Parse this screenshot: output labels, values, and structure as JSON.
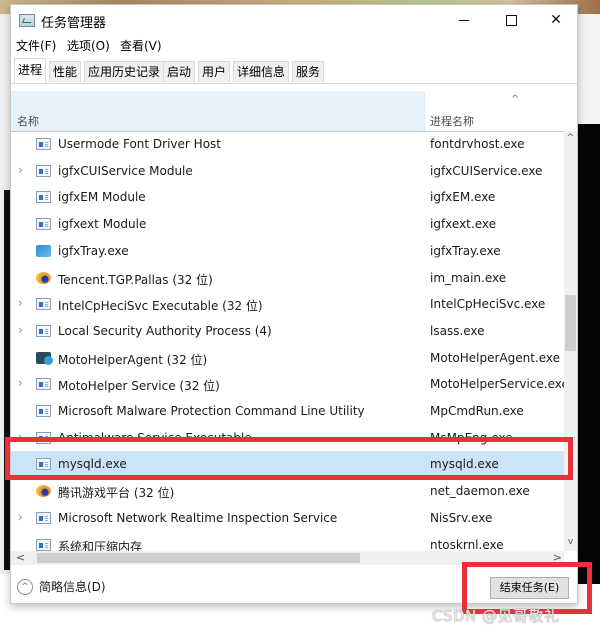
{
  "window": {
    "title": "任务管理器",
    "controls": {
      "minimize": "minimize",
      "maximize": "maximize",
      "close": "✕"
    }
  },
  "menu": [
    "文件(F)",
    "选项(O)",
    "查看(V)"
  ],
  "tabs": [
    {
      "label": "进程",
      "active": true
    },
    {
      "label": "性能"
    },
    {
      "label": "应用历史记录"
    },
    {
      "label": "启动"
    },
    {
      "label": "用户"
    },
    {
      "label": "详细信息"
    },
    {
      "label": "服务"
    }
  ],
  "table": {
    "columns": {
      "name": "名称",
      "process_name": "进程名称",
      "sort_indicator": "^"
    },
    "rows": [
      {
        "name": "Usermode Font Driver Host",
        "process": "fontdrvhost.exe",
        "expandable": false,
        "icon": "window-icon"
      },
      {
        "name": "igfxCUIService Module",
        "process": "igfxCUIService.exe",
        "expandable": true,
        "icon": "window-icon"
      },
      {
        "name": "igfxEM Module",
        "process": "igfxEM.exe",
        "expandable": false,
        "icon": "window-icon"
      },
      {
        "name": "igfxext Module",
        "process": "igfxext.exe",
        "expandable": false,
        "icon": "window-icon"
      },
      {
        "name": "igfxTray.exe",
        "process": "igfxTray.exe",
        "expandable": false,
        "icon": "igfx-tray-icon"
      },
      {
        "name": "Tencent.TGP.Pallas (32 位)",
        "process": "im_main.exe",
        "expandable": false,
        "icon": "tencent-icon"
      },
      {
        "name": "IntelCpHeciSvc Executable (32 位)",
        "process": "IntelCpHeciSvc.exe",
        "expandable": true,
        "icon": "window-icon"
      },
      {
        "name": "Local Security Authority Process (4)",
        "process": "lsass.exe",
        "expandable": true,
        "icon": "window-icon"
      },
      {
        "name": "MotoHelperAgent (32 位)",
        "process": "MotoHelperAgent.exe",
        "expandable": false,
        "icon": "moto-icon"
      },
      {
        "name": "MotoHelper Service (32 位)",
        "process": "MotoHelperService.exe",
        "expandable": true,
        "icon": "window-icon"
      },
      {
        "name": "Microsoft Malware Protection Command Line Utility",
        "process": "MpCmdRun.exe",
        "expandable": false,
        "icon": "window-icon"
      },
      {
        "name": "Antimalware Service Executable",
        "process": "MsMpEng.exe",
        "expandable": true,
        "icon": "window-icon"
      },
      {
        "name": "mysqld.exe",
        "process": "mysqld.exe",
        "expandable": false,
        "icon": "window-icon",
        "selected": true
      },
      {
        "name": "腾讯游戏平台 (32 位)",
        "process": "net_daemon.exe",
        "expandable": false,
        "icon": "tencent-icon"
      },
      {
        "name": "Microsoft Network Realtime Inspection Service",
        "process": "NisSrv.exe",
        "expandable": true,
        "icon": "window-icon"
      },
      {
        "name": "系统和压缩内存",
        "process": "ntoskrnl.exe",
        "expandable": false,
        "icon": "window-icon"
      }
    ]
  },
  "scrollbars": {
    "vertical_position_fraction": 0.45,
    "up": "^",
    "down": "v",
    "left": "<",
    "right": ">"
  },
  "footer": {
    "fewer_details": "简略信息(D)",
    "end_task": "结束任务(E)"
  },
  "annotations": {
    "highlight_color": "#e8323a"
  },
  "watermark": "CSDN @见哥敬礼"
}
